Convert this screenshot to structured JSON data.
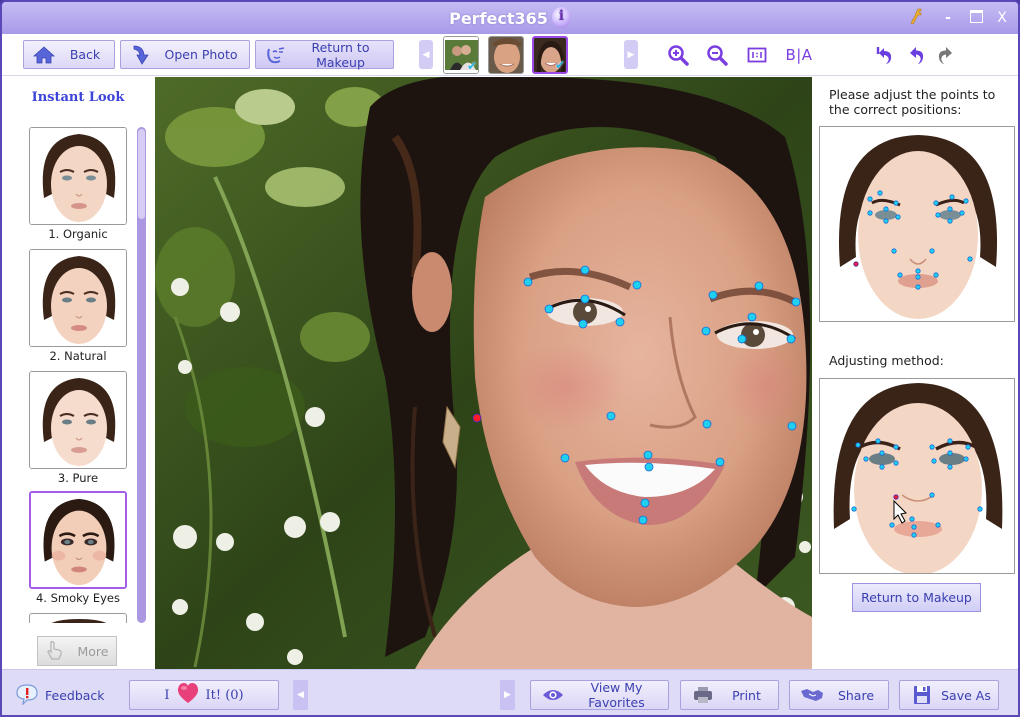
{
  "window": {
    "title": "Perfect365",
    "controls": {
      "minimize": "-",
      "close": "X"
    }
  },
  "toolbar": {
    "back_label": "Back",
    "open_photo_label": "Open Photo",
    "return_to_makeup_label": "Return to Makeup",
    "photo_thumbnails": [
      {
        "name": "couple-photo",
        "checked": true,
        "selected": false
      },
      {
        "name": "man-photo",
        "checked": false,
        "selected": false
      },
      {
        "name": "woman-photo",
        "checked": true,
        "selected": true
      }
    ],
    "tools": [
      "zoom-in",
      "zoom-out",
      "actual-size",
      "before-after",
      "undo-all",
      "undo",
      "redo"
    ],
    "before_after_label": "B|A"
  },
  "instant_look": {
    "title": "Instant Look",
    "items": [
      {
        "label": "1. Organic",
        "selected": false
      },
      {
        "label": "2. Natural",
        "selected": false
      },
      {
        "label": "3. Pure",
        "selected": false
      },
      {
        "label": "4. Smoky Eyes",
        "selected": true
      }
    ],
    "more_label": "More"
  },
  "right_panel": {
    "instruction": "Please adjust the points to the correct positions:",
    "method_label": "Adjusting method:",
    "return_button": "Return to Makeup"
  },
  "landmarks": {
    "point_color": "#1fd0f0",
    "active_point_color": "#ff1a2a"
  },
  "bottom": {
    "feedback_label": "Feedback",
    "love_prefix": "I",
    "love_suffix": "It! (0)",
    "view_favorites_label": "View My Favorites",
    "print_label": "Print",
    "share_label": "Share",
    "save_as_label": "Save As"
  },
  "colors": {
    "accent": "#3a3fb0",
    "title_bar": "#b3a6ee",
    "tool_icon": "#7b3ee0",
    "selection": "#a45ce8"
  }
}
